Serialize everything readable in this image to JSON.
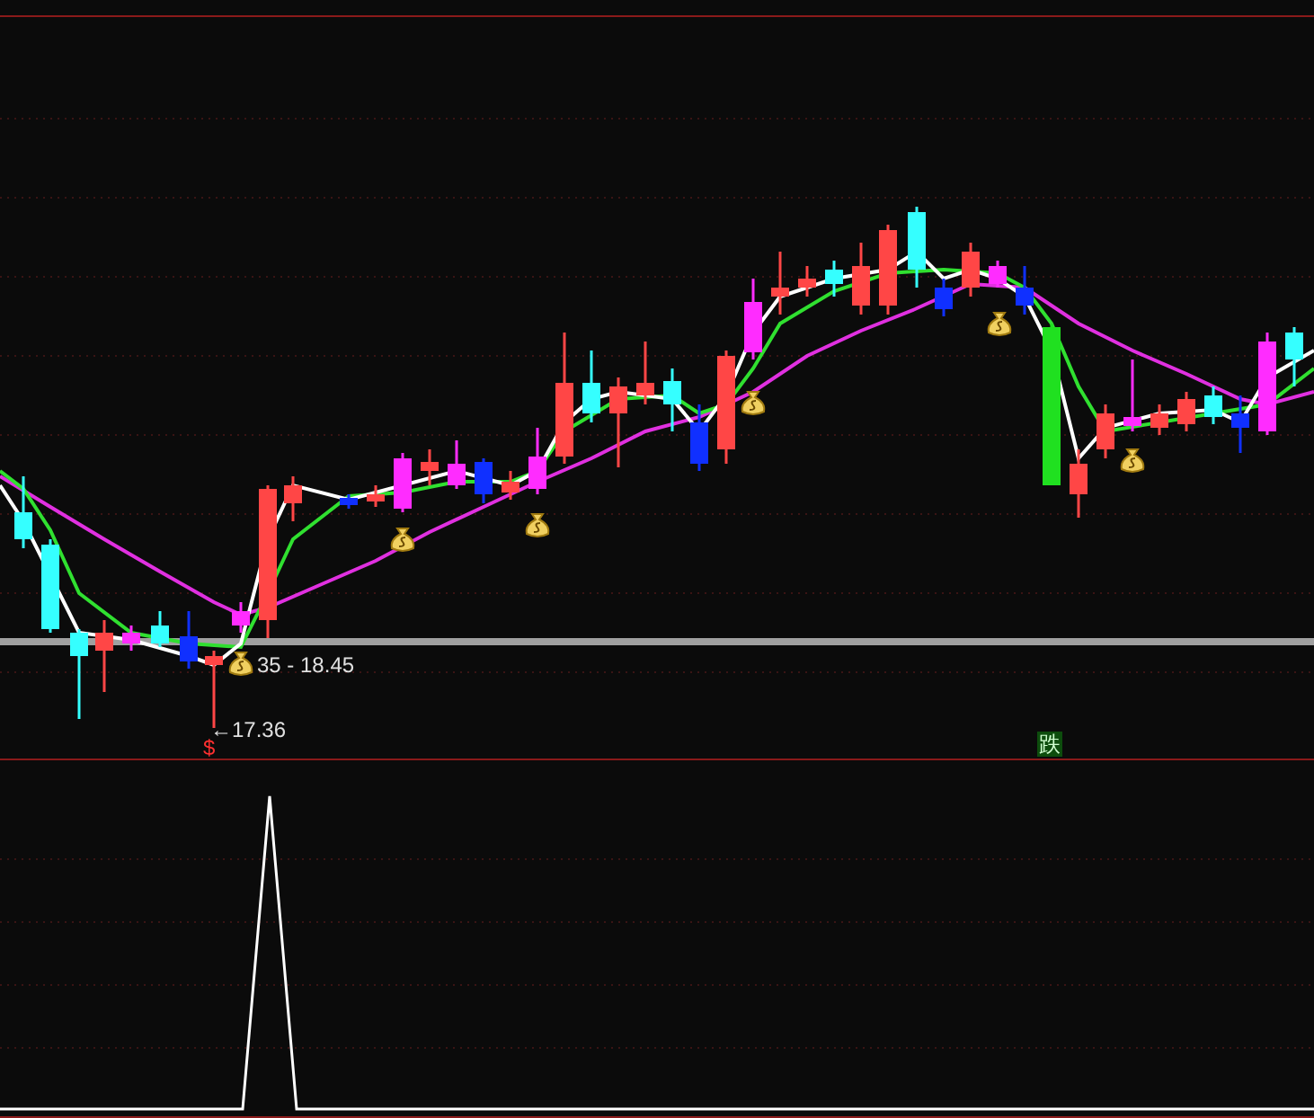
{
  "price_chart": {
    "annotations": [
      {
        "kind": "range",
        "text": "35 - 18.45"
      },
      {
        "kind": "low",
        "text": "←17.36"
      }
    ],
    "signals": [
      {
        "kind": "buy",
        "text": "$"
      },
      {
        "kind": "sell",
        "text": "跌"
      }
    ]
  }
}
